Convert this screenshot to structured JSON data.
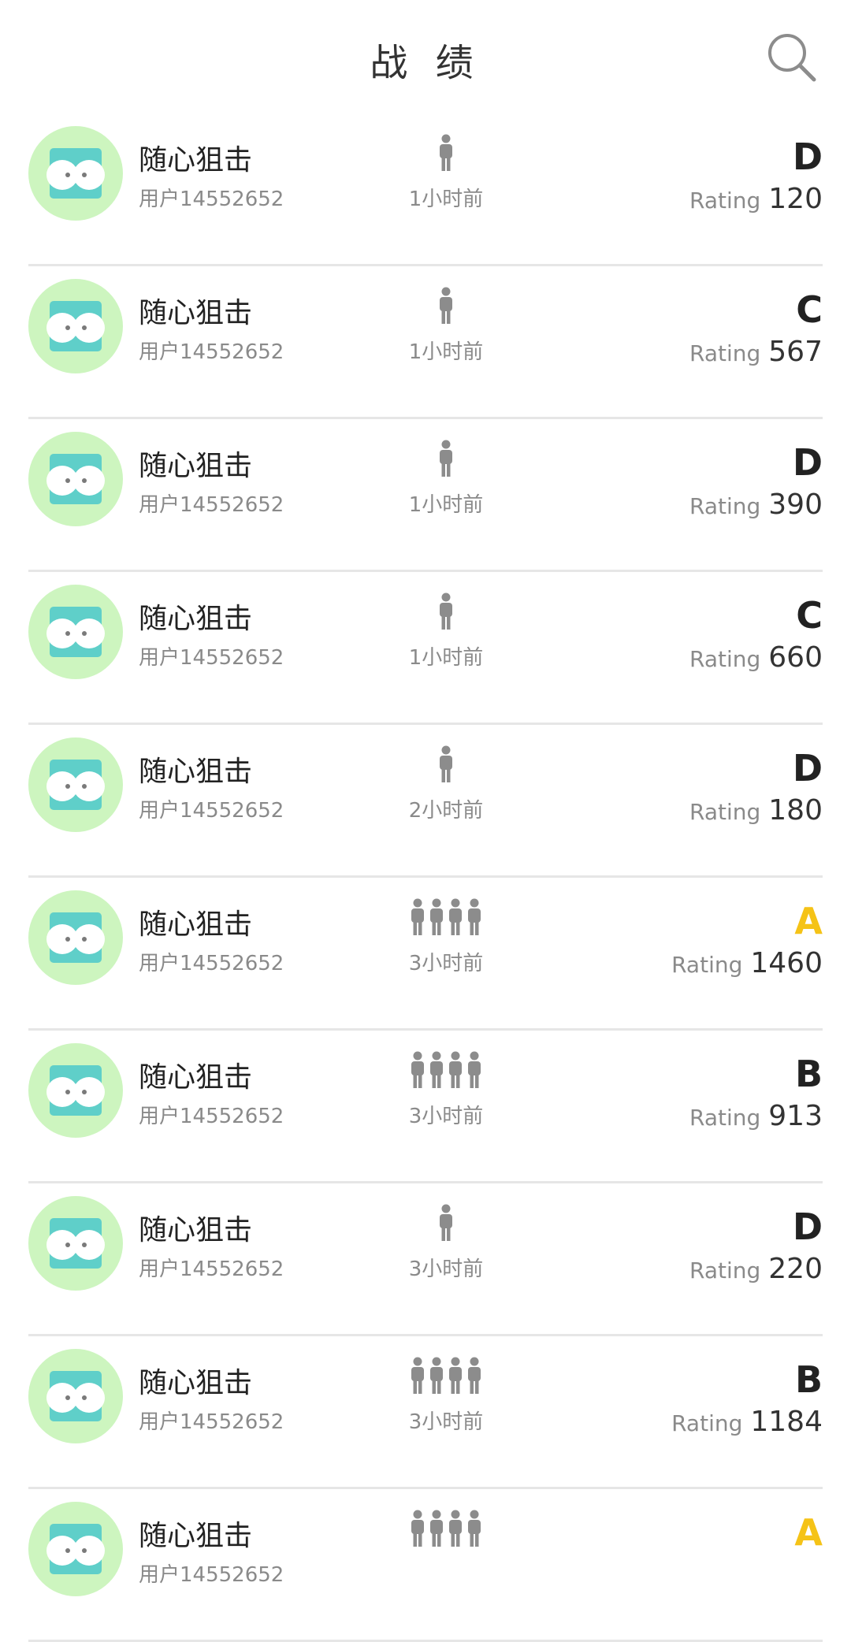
{
  "header": {
    "title": "战 绩"
  },
  "icons": {
    "search": "search-icon",
    "avatar": "avatar-face-icon",
    "player": "person-icon"
  },
  "colors": {
    "avatar_bg": "#cdf5bf",
    "avatar_face": "#5fcfc9",
    "grade_gold": "#f5c317",
    "icon_gray": "#8c8c8c"
  },
  "rating_label": "Rating",
  "records": [
    {
      "name": "随心狙击",
      "user": "用户14552652",
      "players": 1,
      "time": "1小时前",
      "grade": "D",
      "rating": "120"
    },
    {
      "name": "随心狙击",
      "user": "用户14552652",
      "players": 1,
      "time": "1小时前",
      "grade": "C",
      "rating": "567"
    },
    {
      "name": "随心狙击",
      "user": "用户14552652",
      "players": 1,
      "time": "1小时前",
      "grade": "D",
      "rating": "390"
    },
    {
      "name": "随心狙击",
      "user": "用户14552652",
      "players": 1,
      "time": "1小时前",
      "grade": "C",
      "rating": "660"
    },
    {
      "name": "随心狙击",
      "user": "用户14552652",
      "players": 1,
      "time": "2小时前",
      "grade": "D",
      "rating": "180"
    },
    {
      "name": "随心狙击",
      "user": "用户14552652",
      "players": 4,
      "time": "3小时前",
      "grade": "A",
      "rating": "1460"
    },
    {
      "name": "随心狙击",
      "user": "用户14552652",
      "players": 4,
      "time": "3小时前",
      "grade": "B",
      "rating": "913"
    },
    {
      "name": "随心狙击",
      "user": "用户14552652",
      "players": 1,
      "time": "3小时前",
      "grade": "D",
      "rating": "220"
    },
    {
      "name": "随心狙击",
      "user": "用户14552652",
      "players": 4,
      "time": "3小时前",
      "grade": "B",
      "rating": "1184"
    },
    {
      "name": "随心狙击",
      "user": "用户14552652",
      "players": 4,
      "time": "",
      "grade": "A",
      "rating": ""
    }
  ]
}
